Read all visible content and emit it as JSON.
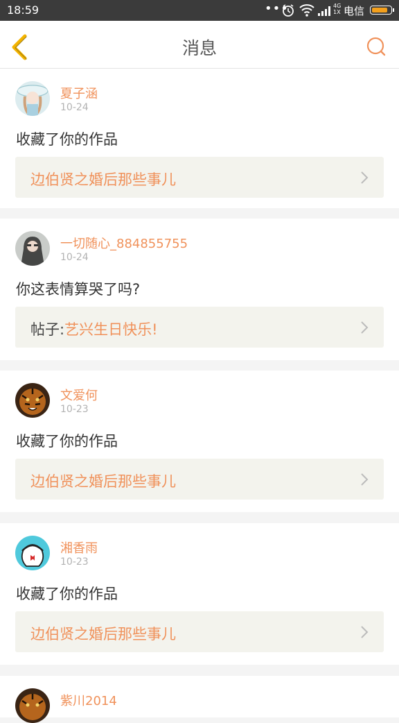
{
  "status": {
    "time": "18:59",
    "dots": "•••",
    "carrier": "电信",
    "net_top": "4G",
    "net_bottom": "1X",
    "battery_level": 0.85
  },
  "header": {
    "title": "消息"
  },
  "messages": [
    {
      "user": "夏子涵",
      "date": "10-24",
      "text": "收藏了你的作品",
      "ref_prefix": "",
      "ref_title": "边伯贤之婚后那些事儿"
    },
    {
      "user": "一切随心_884855755",
      "date": "10-24",
      "text": "你这表情算哭了吗?",
      "ref_prefix": "帖子:",
      "ref_title": "艺兴生日快乐!"
    },
    {
      "user": "文爱何",
      "date": "10-23",
      "text": "收藏了你的作品",
      "ref_prefix": "",
      "ref_title": "边伯贤之婚后那些事儿"
    },
    {
      "user": "湘香雨",
      "date": "10-23",
      "text": "收藏了你的作品",
      "ref_prefix": "",
      "ref_title": "边伯贤之婚后那些事儿"
    },
    {
      "user": "紫川2014",
      "date": "",
      "text": "",
      "ref_prefix": "",
      "ref_title": ""
    }
  ],
  "colors": {
    "accent": "#f0915a",
    "back_arrow": "#f4b400",
    "statusbar": "#3b3b3b"
  }
}
